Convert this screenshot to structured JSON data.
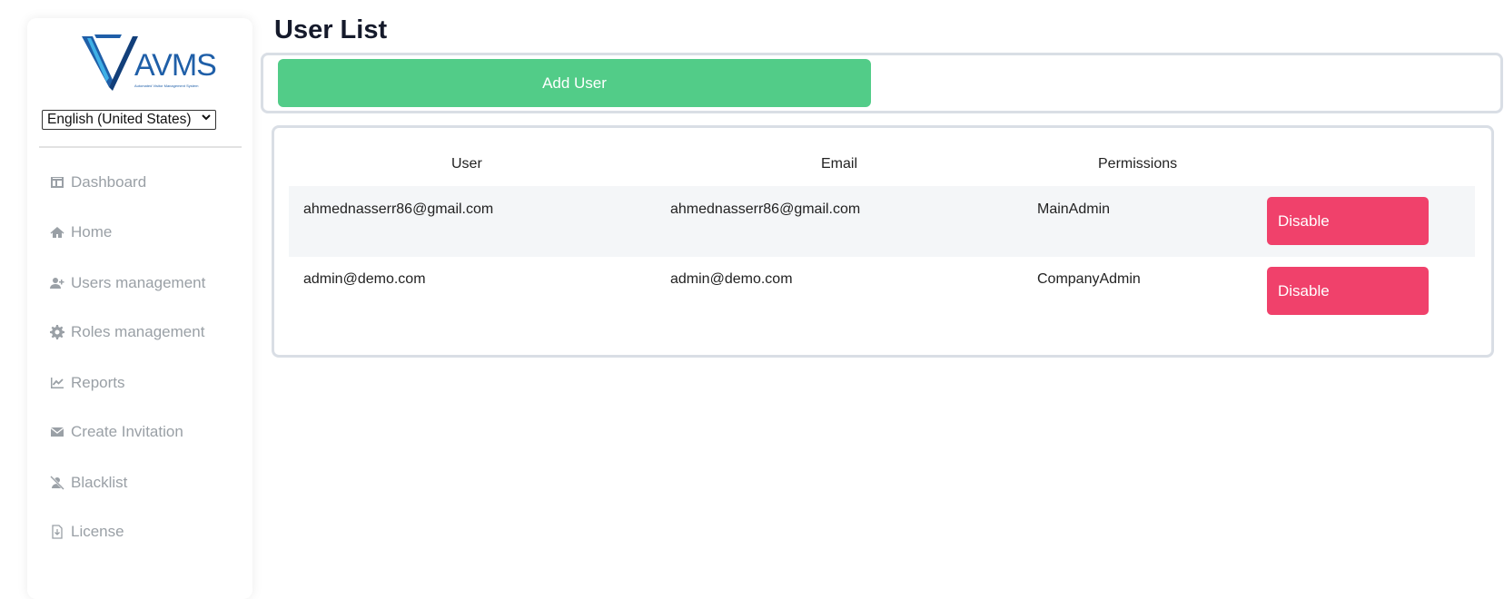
{
  "brand": {
    "logo_text": "AVMS",
    "logo_subtitle": "Automated Visitor Management System"
  },
  "language": {
    "selected": "English (United States)"
  },
  "sidebar": {
    "items": [
      {
        "label": "Dashboard",
        "icon": "dashboard-icon"
      },
      {
        "label": "Home",
        "icon": "home-icon"
      },
      {
        "label": "Users management",
        "icon": "user-plus-icon"
      },
      {
        "label": "Roles management",
        "icon": "gear-icon"
      },
      {
        "label": "Reports",
        "icon": "chart-line-icon"
      },
      {
        "label": "Create Invitation",
        "icon": "envelope-icon"
      },
      {
        "label": "Blacklist",
        "icon": "user-slash-icon"
      },
      {
        "label": "License",
        "icon": "file-download-icon"
      }
    ]
  },
  "main": {
    "title": "User List",
    "add_button": "Add User",
    "table": {
      "headers": [
        "User",
        "Email",
        "Permissions"
      ],
      "rows": [
        {
          "user": "ahmednasserr86@gmail.com",
          "email": "ahmednasserr86@gmail.com",
          "permissions": "MainAdmin",
          "action": "Disable"
        },
        {
          "user": "admin@demo.com",
          "email": "admin@demo.com",
          "permissions": "CompanyAdmin",
          "action": "Disable"
        }
      ]
    }
  },
  "colors": {
    "add_button": "#52cc88",
    "disable_button": "#f0416b",
    "nav_text": "#9aa0a6",
    "title_text": "#151a2b"
  }
}
